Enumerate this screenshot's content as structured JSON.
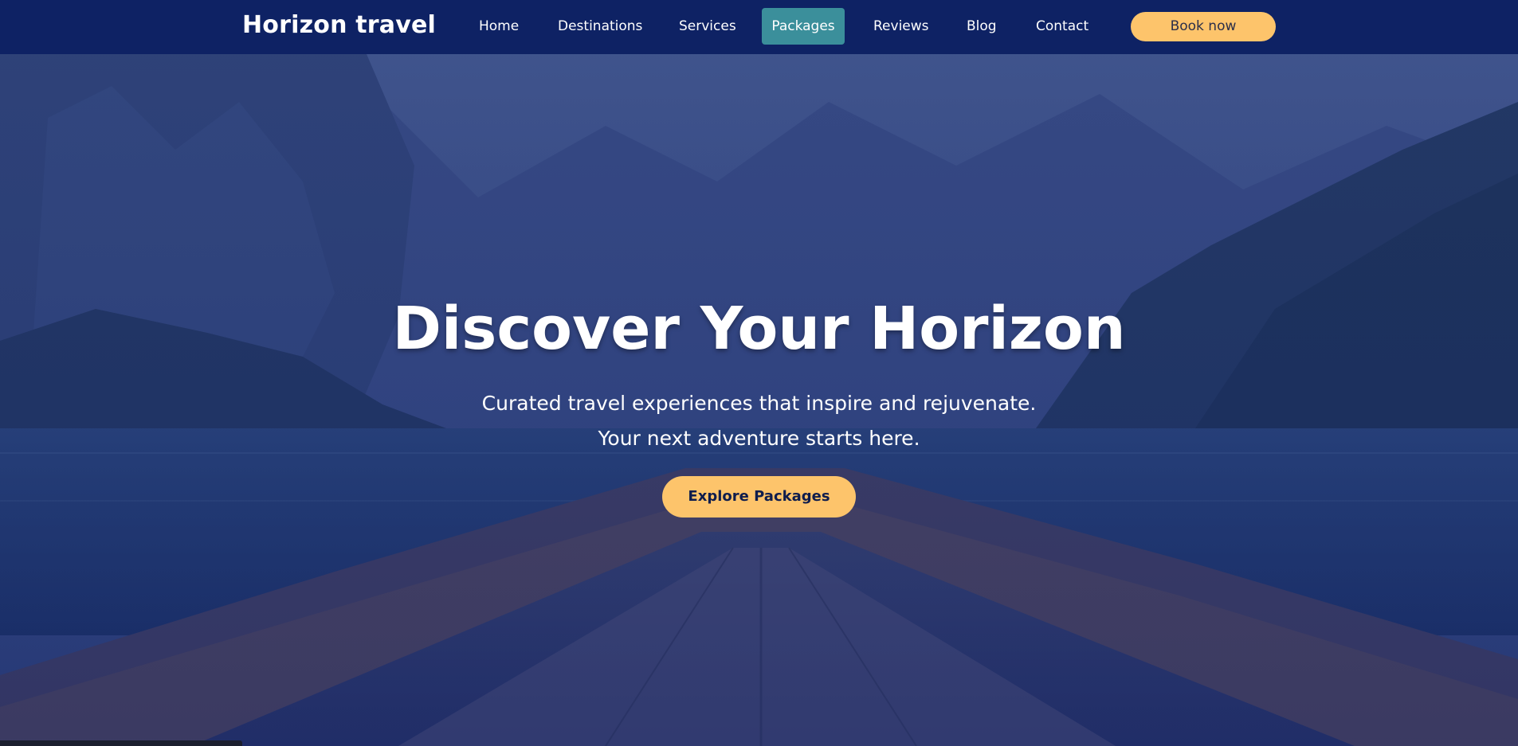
{
  "header": {
    "brand": "Horizon travel",
    "nav": [
      {
        "label": "Home"
      },
      {
        "label": "Destinations"
      },
      {
        "label": "Services"
      },
      {
        "label": "Packages",
        "active": true
      },
      {
        "label": "Reviews"
      },
      {
        "label": "Blog"
      },
      {
        "label": "Contact"
      }
    ],
    "cta_label": "Book now"
  },
  "hero": {
    "title": "Discover Your Horizon",
    "subtitle_line1": "Curated travel experiences that inspire and rejuvenate.",
    "subtitle_line2": "Your next adventure starts here.",
    "button_label": "Explore Packages"
  },
  "colors": {
    "nav_background": "#0e2264",
    "active_tab": "#3b8f9b",
    "accent_button": "#fdc46b",
    "hero_overlay": "#1f3175"
  }
}
